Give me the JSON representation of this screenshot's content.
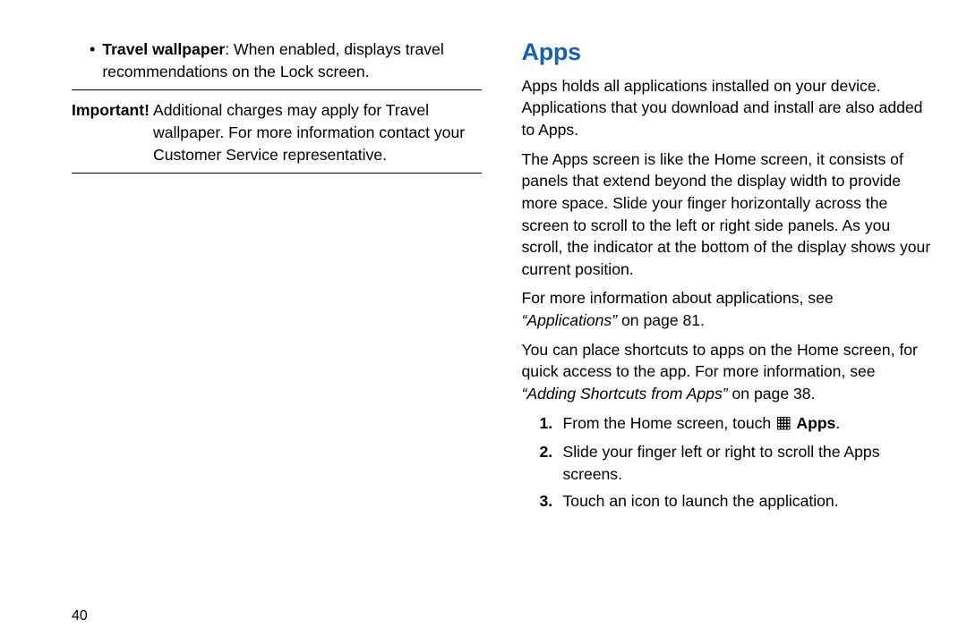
{
  "left": {
    "bullet": {
      "term": "Travel wallpaper",
      "desc": ": When enabled, displays travel recommendations on the Lock screen."
    },
    "important": {
      "label": "Important!",
      "body": " Additional charges may apply for Travel wallpaper. For more information contact your Customer Service representative."
    }
  },
  "right": {
    "heading": "Apps",
    "p1": "Apps holds all applications installed on your device. Applications that you download and install are also added to Apps.",
    "p2": "The Apps screen is like the Home screen, it consists of panels that extend beyond the display width to provide more space. Slide your finger horizontally across the screen to scroll to the left or right side panels. As you scroll, the indicator at the bottom of the display shows your current position.",
    "p3_pre": "For more information about applications, see ",
    "p3_ref": "“Applications”",
    "p3_post": " on page 81.",
    "p4_pre": "You can place shortcuts to apps on the Home screen, for quick access to the app. For more information, see ",
    "p4_ref": "“Adding Shortcuts from Apps”",
    "p4_post": " on page 38.",
    "steps": {
      "n1": "1.",
      "s1_pre": "From the Home screen, touch ",
      "s1_bold": " Apps",
      "s1_post": ".",
      "n2": "2.",
      "s2": "Slide your finger left or right to scroll the Apps screens.",
      "n3": "3.",
      "s3": "Touch an icon to launch the application."
    }
  },
  "pageNumber": "40"
}
